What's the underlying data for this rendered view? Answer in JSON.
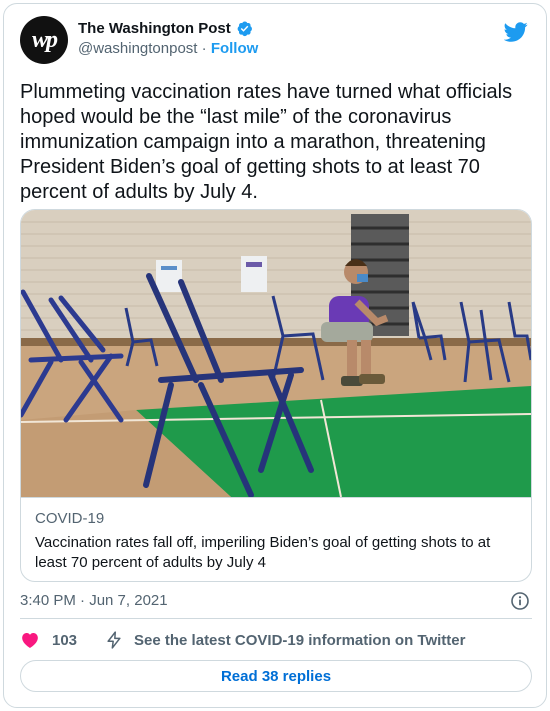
{
  "author": {
    "avatar_text": "wp",
    "display_name": "The Washington Post",
    "handle": "@washingtonpost",
    "separator": "·",
    "follow_label": "Follow",
    "verified": true
  },
  "tweet": {
    "text": "Plummeting vaccination rates have turned what officials hoped would be the “last mile” of the coronavirus immunization campaign into a marathon, threatening President Biden’s goal of getting shots to at least 70 percent of adults by July 4."
  },
  "link_card": {
    "domain": "COVID-19",
    "title": "Vaccination rates fall off, imperiling Biden’s goal of getting shots to at least 70 percent of adults by July 4"
  },
  "meta": {
    "timestamp": "3:40 PM · Jun 7, 2021"
  },
  "actions": {
    "like_count": "103",
    "info_text": "See the latest COVID-19 information on Twitter"
  },
  "replies_button": {
    "label": "Read 38 replies"
  },
  "colors": {
    "twitter_blue": "#1d9bf0",
    "like_red": "#f91880",
    "reply_link": "#006fd6",
    "secondary_text": "#536471",
    "border": "#cfd9de"
  },
  "icons": [
    "verified-badge-icon",
    "twitter-bird-icon",
    "info-icon",
    "heart-icon",
    "lightning-icon"
  ]
}
